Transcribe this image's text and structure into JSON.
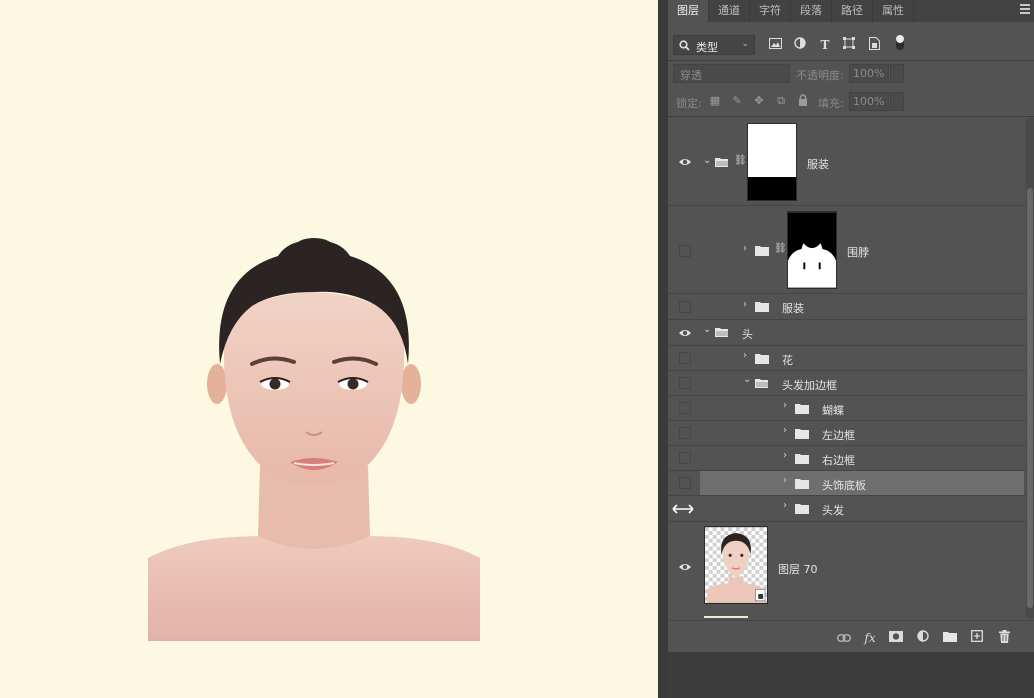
{
  "tabs": [
    {
      "label": "图层",
      "active": true
    },
    {
      "label": "通道"
    },
    {
      "label": "字符"
    },
    {
      "label": "段落"
    },
    {
      "label": "路径"
    },
    {
      "label": "属性"
    }
  ],
  "filter": {
    "kind_label": "类型"
  },
  "blend": {
    "mode": "穿透",
    "opacity_label": "不透明度:",
    "opacity_value": "100%"
  },
  "lock": {
    "label": "锁定:",
    "fill_label": "填充:",
    "fill_value": "100%"
  },
  "layers": [
    {
      "name": "服装",
      "visible": true,
      "expanded": true,
      "mask": true
    },
    {
      "name": "围脖",
      "visible": false,
      "expanded": false,
      "mask": true
    },
    {
      "name": "服装",
      "visible": false,
      "expanded": false
    },
    {
      "name": "头",
      "visible": true,
      "expanded": true
    },
    {
      "name": "花",
      "visible": false,
      "expanded": false
    },
    {
      "name": "头发加边框",
      "visible": false,
      "expanded": true
    },
    {
      "name": "蝴蝶",
      "visible": false,
      "expanded": false
    },
    {
      "name": "左边框",
      "visible": false,
      "expanded": false
    },
    {
      "name": "右边框",
      "visible": false,
      "expanded": false
    },
    {
      "name": "头饰底板",
      "visible": false,
      "expanded": false,
      "selected": true
    },
    {
      "name": "头发",
      "visible": false,
      "expanded": false
    },
    {
      "name": "图层 70",
      "visible": true,
      "thumbnail": "portrait"
    }
  ],
  "colors": {
    "canvas_bg": "#fdf8e2",
    "panel_bg": "#535353",
    "selected_row": "#6e6e6e"
  }
}
